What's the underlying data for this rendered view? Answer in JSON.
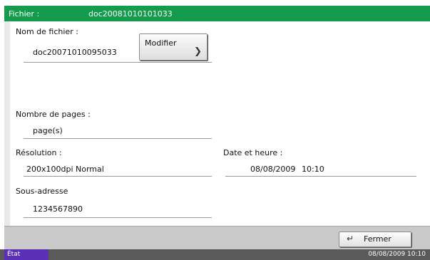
{
  "header": {
    "file_label": "Fichier :",
    "file_value": "doc20081010101033"
  },
  "fields": {
    "filename_label": "Nom de fichier :",
    "filename_value": "doc20071010095033",
    "modify_button": "Modifier",
    "pages_label": "Nombre de pages :",
    "pages_value": "page(s)",
    "resolution_label": "Résolution :",
    "resolution_value": "200x100dpi Normal",
    "datetime_label": "Date et heure :",
    "date_value": "08/08/2009",
    "time_value": "10:10",
    "subaddress_label": "Sous-adresse",
    "subaddress_value": "1234567890"
  },
  "footer": {
    "close_button": "Fermer"
  },
  "status": {
    "etat_label": "État",
    "datetime": "08/08/2009   10:10"
  },
  "colors": {
    "titlebar": "#149c4c",
    "etat": "#5b2fb6"
  },
  "icons": {
    "modify": "chevron-right-icon",
    "close": "enter-return-icon"
  }
}
